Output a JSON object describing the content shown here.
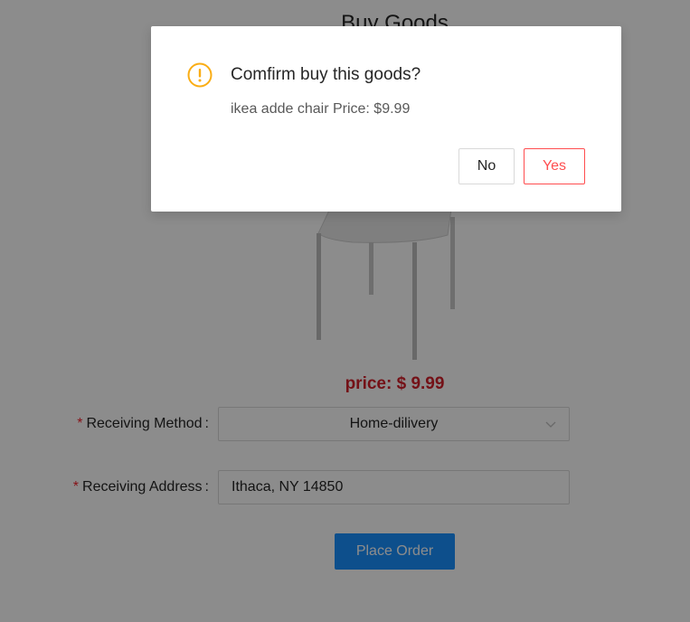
{
  "page": {
    "title": "Buy Goods",
    "product_image_alt": "chair",
    "price_label": "price: $ 9.99"
  },
  "form": {
    "method_required_mark": "*",
    "method_label": "Receiving Method",
    "method_colon": ":",
    "method_value": "Home-dilivery",
    "address_required_mark": "*",
    "address_label": "Receiving Address",
    "address_colon": ":",
    "address_value": "Ithaca, NY 14850",
    "place_order_label": "Place Order"
  },
  "modal": {
    "icon": "exclamation-circle-icon",
    "title": "Comfirm buy this goods?",
    "content": "ikea adde chair Price: $9.99",
    "no_label": "No",
    "yes_label": "Yes"
  },
  "colors": {
    "primary": "#1890ff",
    "danger": "#ff4d4f",
    "warning": "#faad14",
    "price": "#d4202a",
    "mask": "rgba(0,0,0,0.45)"
  }
}
